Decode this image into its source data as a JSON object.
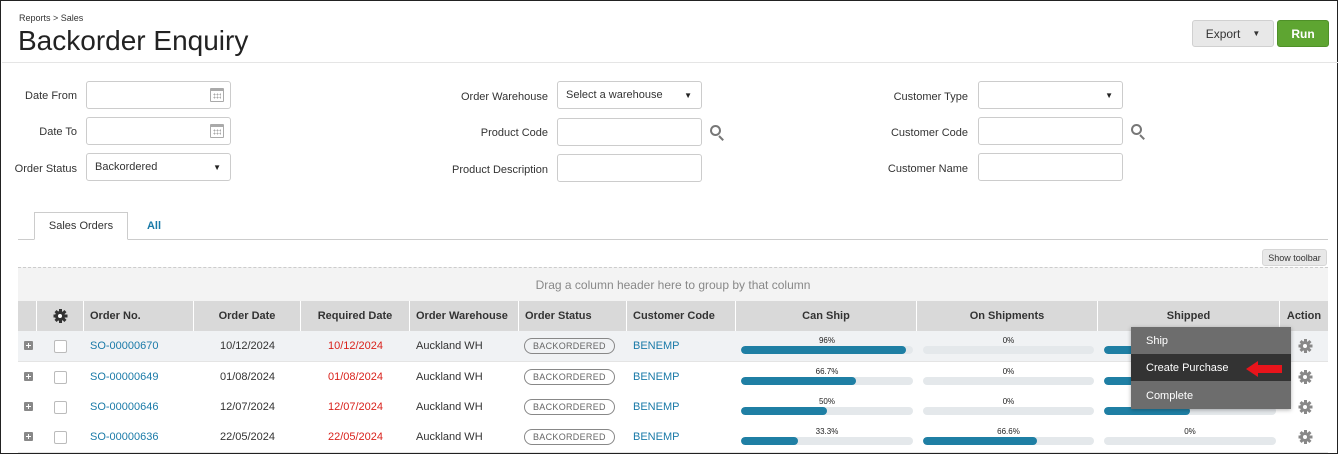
{
  "breadcrumb": "Reports > Sales",
  "page_title": "Backorder Enquiry",
  "toolbar": {
    "export_label": "Export",
    "run_label": "Run",
    "run_color": "#5ea531"
  },
  "filters": {
    "date_from_label": "Date From",
    "date_to_label": "Date To",
    "order_status_label": "Order Status",
    "order_status_value": "Backordered",
    "order_warehouse_label": "Order Warehouse",
    "order_warehouse_value": "Select a warehouse",
    "product_code_label": "Product Code",
    "product_description_label": "Product Description",
    "customer_type_label": "Customer Type",
    "customer_code_label": "Customer Code",
    "customer_name_label": "Customer Name"
  },
  "tabs": [
    {
      "label": "Sales Orders"
    },
    {
      "label": "All"
    }
  ],
  "grid": {
    "show_toolbar_label": "Show toolbar",
    "group_hint": "Drag a column header here to group by that column",
    "columns": [
      "Order No.",
      "Order Date",
      "Required Date",
      "Order Warehouse",
      "Order Status",
      "Customer Code",
      "Can Ship",
      "On Shipments",
      "Shipped",
      "Action"
    ],
    "rows": [
      {
        "order_no": "SO-00000670",
        "order_date": "10/12/2024",
        "required_date": "10/12/2024",
        "warehouse": "Auckland WH",
        "status": "BACKORDERED",
        "customer": "BENEMP",
        "can_ship_label": "96%",
        "can_ship": 0.96,
        "on_ship_label": "0%",
        "on_ship": 0,
        "shipped": null
      },
      {
        "order_no": "SO-00000649",
        "order_date": "01/08/2024",
        "required_date": "01/08/2024",
        "warehouse": "Auckland WH",
        "status": "BACKORDERED",
        "customer": "BENEMP",
        "can_ship_label": "66.7%",
        "can_ship": 0.667,
        "on_ship_label": "0%",
        "on_ship": 0,
        "shipped": null
      },
      {
        "order_no": "SO-00000646",
        "order_date": "12/07/2024",
        "required_date": "12/07/2024",
        "warehouse": "Auckland WH",
        "status": "BACKORDERED",
        "customer": "BENEMP",
        "can_ship_label": "50%",
        "can_ship": 0.5,
        "on_ship_label": "0%",
        "on_ship": 0,
        "shipped": null
      },
      {
        "order_no": "SO-00000636",
        "order_date": "22/05/2024",
        "required_date": "22/05/2024",
        "warehouse": "Auckland WH",
        "status": "BACKORDERED",
        "customer": "BENEMP",
        "can_ship_label": "33.3%",
        "can_ship": 0.333,
        "on_ship_label": "66.6%",
        "on_ship": 0.666,
        "shipped_label": "0%",
        "shipped": 0
      }
    ]
  },
  "action_menu": {
    "items": [
      "Ship",
      "Create Purchase",
      "Complete"
    ],
    "highlighted": "Create Purchase"
  },
  "colors": {
    "link": "#1a7aa8",
    "required_date": "#d9221c",
    "progress": "#1f7fa4",
    "arrow": "#e8141b"
  }
}
